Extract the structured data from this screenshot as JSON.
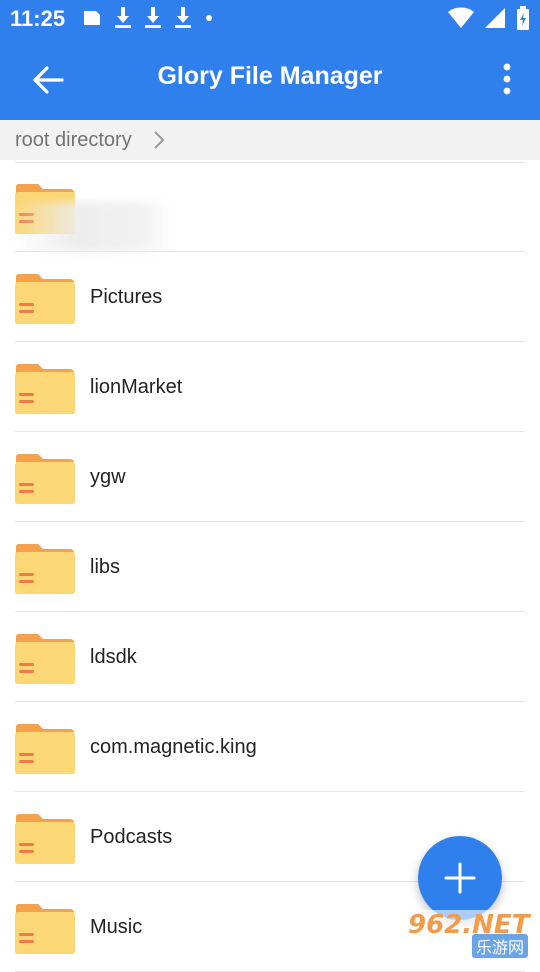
{
  "status_bar": {
    "time": "11:25",
    "left_icons": [
      "sd-card-icon",
      "download-icon",
      "download-icon",
      "download-icon",
      "dot-icon"
    ],
    "right_icons": [
      "wifi-icon",
      "signal-icon",
      "battery-icon"
    ]
  },
  "app_bar": {
    "title": "Glory File Manager",
    "back_icon": "arrow-left-icon",
    "menu_icon": "more-vertical-icon"
  },
  "breadcrumb": {
    "label": "root directory"
  },
  "folders": [
    {
      "name": ""
    },
    {
      "name": "Pictures"
    },
    {
      "name": "lionMarket"
    },
    {
      "name": "ygw"
    },
    {
      "name": "libs"
    },
    {
      "name": "ldsdk"
    },
    {
      "name": "com.magnetic.king"
    },
    {
      "name": "Podcasts"
    },
    {
      "name": "Music"
    }
  ],
  "fab": {
    "icon": "plus-icon"
  },
  "watermark": {
    "main": "962.NET",
    "sub": "乐游网"
  },
  "colors": {
    "primary": "#2f80ed",
    "folder": "#fcd775",
    "folder_tab": "#f4a24b",
    "folder_mark": "#f07a4a"
  }
}
